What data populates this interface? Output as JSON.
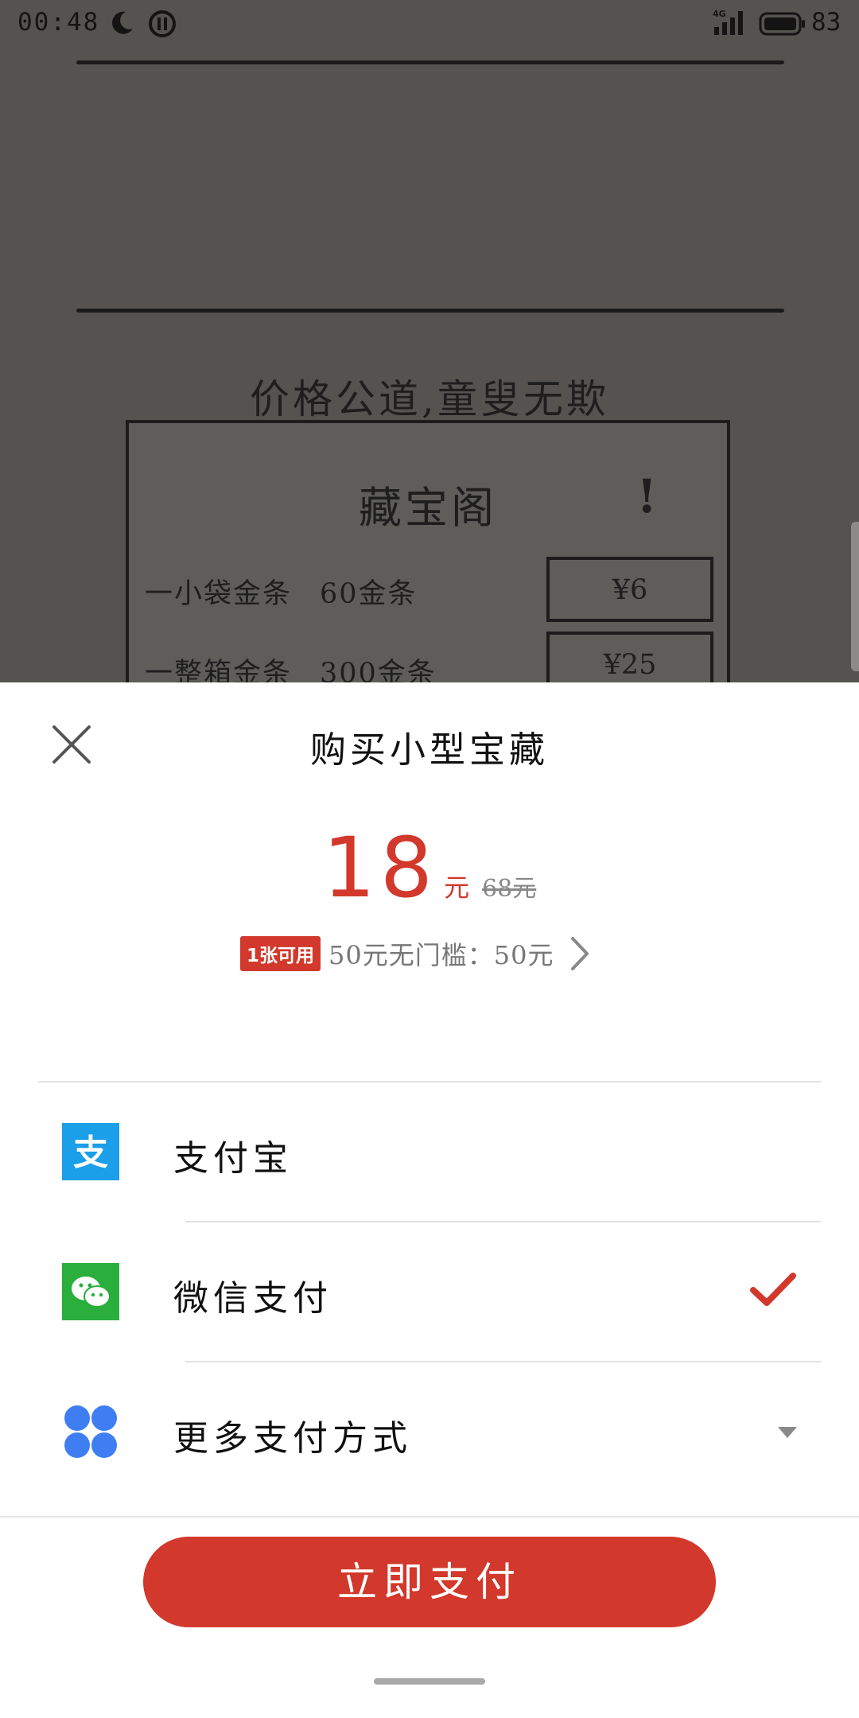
{
  "status_bar": {
    "time": "00:48",
    "network": "4G",
    "battery": "83"
  },
  "background": {
    "slogan": "价格公道,童叟无欺",
    "shop_title": "藏宝阁",
    "shop_mark": "!",
    "items": [
      {
        "name": "一小袋金条",
        "qty": "60金条",
        "price": "¥6"
      },
      {
        "name": "一整箱金条",
        "qty": "300金条",
        "price": "¥25"
      }
    ]
  },
  "sheet": {
    "title": "购买小型宝藏",
    "price": "18",
    "price_unit": "元",
    "original_price": "68元",
    "coupon_badge": "1张可用",
    "coupon_text": "50元无门槛：50元",
    "payment_methods": [
      {
        "label": "支付宝",
        "icon": "alipay-icon",
        "selected": false
      },
      {
        "label": "微信支付",
        "icon": "wechat-pay-icon",
        "selected": true
      },
      {
        "label": "更多支付方式",
        "icon": "more-methods-icon",
        "selected": false
      }
    ],
    "pay_button": "立即支付"
  },
  "colors": {
    "accent": "#d2382b",
    "alipay": "#1a9fe8",
    "wechat": "#2aae3c",
    "more": "#3e7ef2"
  }
}
